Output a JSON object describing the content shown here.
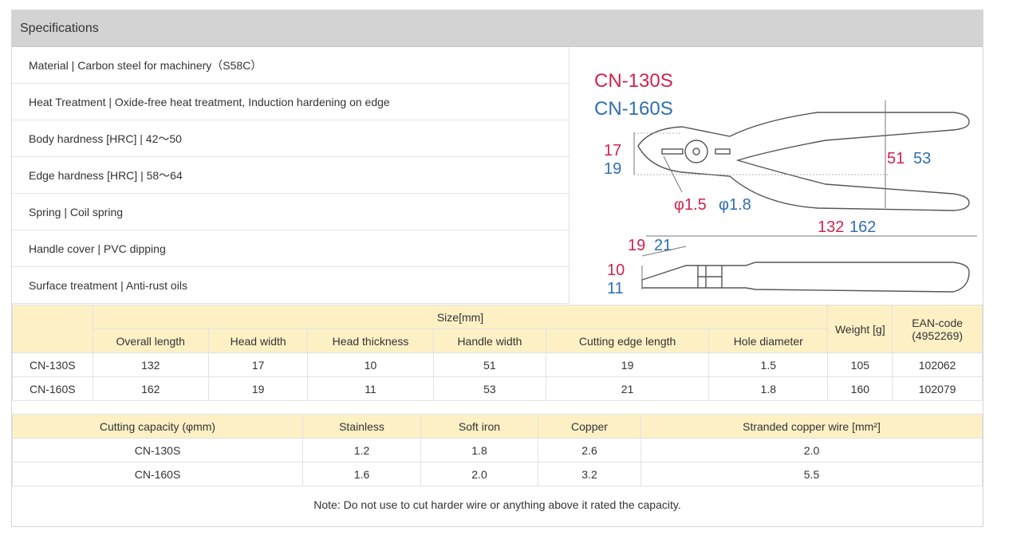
{
  "panel": {
    "title": "Specifications"
  },
  "specs": [
    "Material | Carbon steel for machinery（S58C）",
    "Heat Treatment | Oxide-free heat treatment, Induction hardening on edge",
    "Body hardness [HRC] | 42～50",
    "Edge hardness [HRC] | 58～64",
    "Spring | Coil spring",
    "Handle cover | PVC dipping",
    "Surface treatment | Anti-rust oils"
  ],
  "diagram": {
    "model_a": "CN-130S",
    "model_b": "CN-160S",
    "head_width": [
      "17",
      "19"
    ],
    "hole": [
      "φ1.5",
      "φ1.8"
    ],
    "handle_width": [
      "51",
      "53"
    ],
    "overall_length": [
      "132",
      "162"
    ],
    "edge_length": [
      "19",
      "21"
    ],
    "head_thickness": [
      "10",
      "11"
    ],
    "colors": {
      "model_a": "#d0234d",
      "model_b": "#2f6fb0"
    }
  },
  "size_table": {
    "size_header": "Size[mm]",
    "weight_header": "Weight [g]",
    "ean_header": "EAN-code (4952269)",
    "columns": [
      "Overall length",
      "Head width",
      "Head thickness",
      "Handle width",
      "Cutting edge length",
      "Hole diameter"
    ],
    "rows": [
      {
        "model": "CN-130S",
        "values": [
          "132",
          "17",
          "10",
          "51",
          "19",
          "1.5"
        ],
        "weight": "105",
        "ean": "102062"
      },
      {
        "model": "CN-160S",
        "values": [
          "162",
          "19",
          "11",
          "53",
          "21",
          "1.8"
        ],
        "weight": "160",
        "ean": "102079"
      }
    ]
  },
  "capacity_table": {
    "columns": [
      "Cutting capacity (φmm)",
      "Stainless",
      "Soft iron",
      "Copper",
      "Stranded copper wire [mm²]"
    ],
    "rows": [
      [
        "CN-130S",
        "1.2",
        "1.8",
        "2.6",
        "2.0"
      ],
      [
        "CN-160S",
        "1.6",
        "2.0",
        "3.2",
        "5.5"
      ]
    ]
  },
  "note": "Note: Do not use to cut harder wire or anything above it rated the capacity.",
  "header_bg": "#fdf0c5"
}
